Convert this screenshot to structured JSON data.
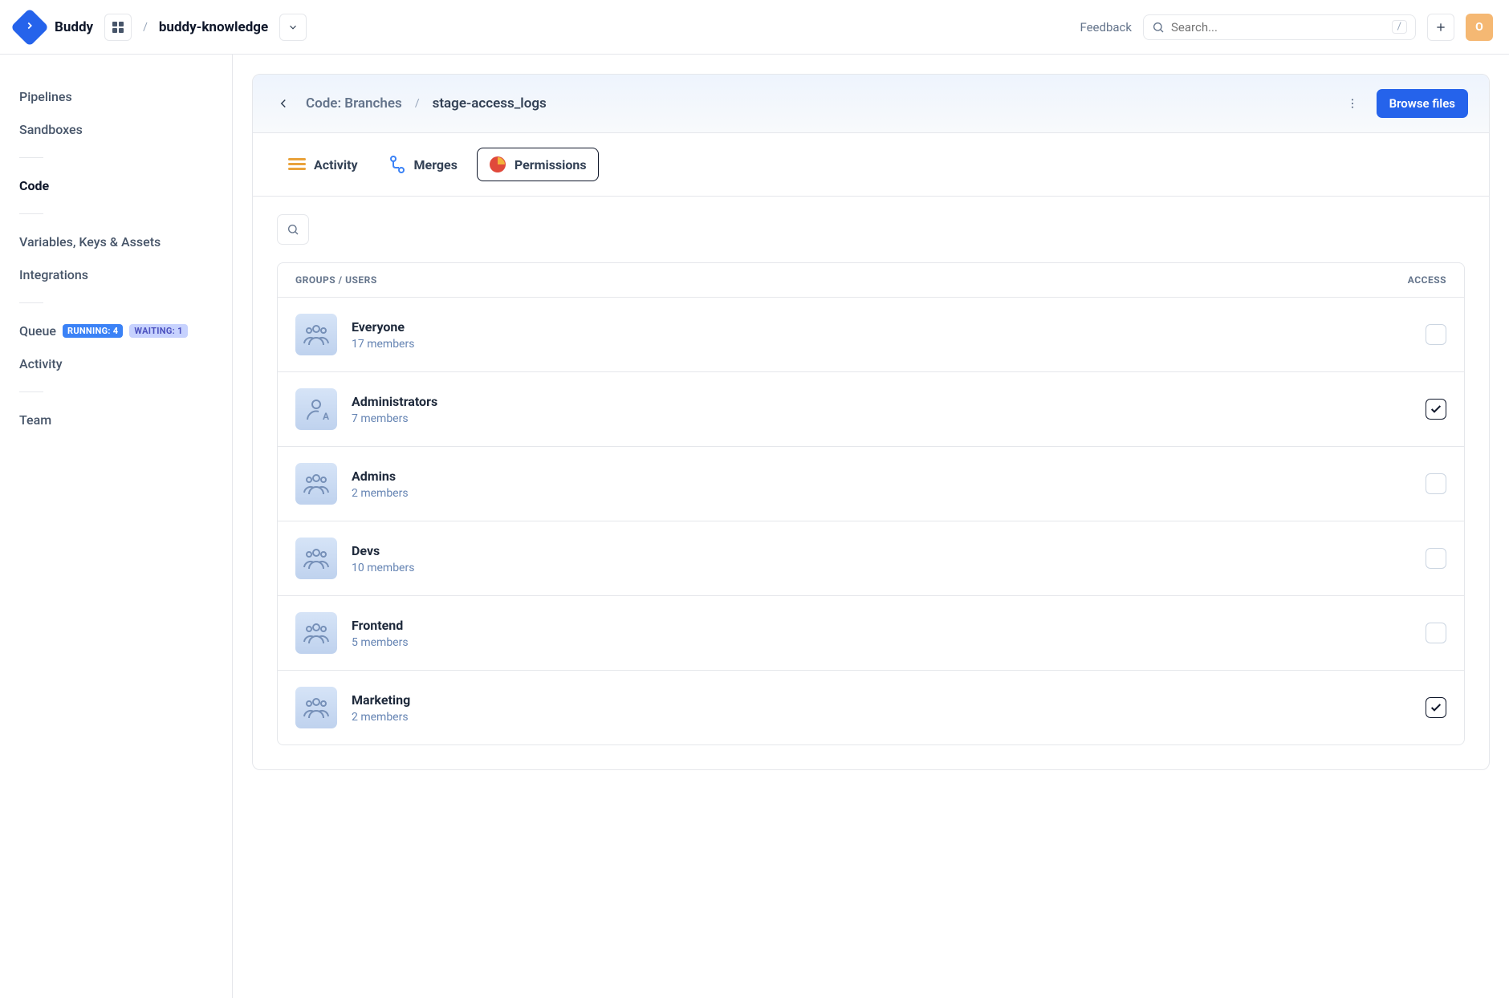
{
  "header": {
    "brand": "Buddy",
    "project": "buddy-knowledge",
    "feedback": "Feedback",
    "searchPlaceholder": "Search...",
    "searchShortcut": "/",
    "avatarInitial": "O"
  },
  "sidebar": {
    "items": {
      "pipelines": "Pipelines",
      "sandboxes": "Sandboxes",
      "code": "Code",
      "variables": "Variables, Keys & Assets",
      "integrations": "Integrations",
      "queue": "Queue",
      "activity": "Activity",
      "team": "Team"
    },
    "badges": {
      "running": "RUNNING: 4",
      "waiting": "WAITING: 1"
    }
  },
  "breadcrumb": {
    "parent": "Code: Branches",
    "current": "stage-access_logs",
    "browse": "Browse files"
  },
  "tabs": {
    "activity": "Activity",
    "merges": "Merges",
    "permissions": "Permissions"
  },
  "tableHeaders": {
    "left": "GROUPS / USERS",
    "right": "ACCESS"
  },
  "groups": [
    {
      "name": "Everyone",
      "members": "17 members",
      "checked": false,
      "kind": "group"
    },
    {
      "name": "Administrators",
      "members": "7 members",
      "checked": true,
      "kind": "admin"
    },
    {
      "name": "Admins",
      "members": "2 members",
      "checked": false,
      "kind": "group"
    },
    {
      "name": "Devs",
      "members": "10 members",
      "checked": false,
      "kind": "group"
    },
    {
      "name": "Frontend",
      "members": "5 members",
      "checked": false,
      "kind": "group"
    },
    {
      "name": "Marketing",
      "members": "2 members",
      "checked": true,
      "kind": "group"
    }
  ]
}
